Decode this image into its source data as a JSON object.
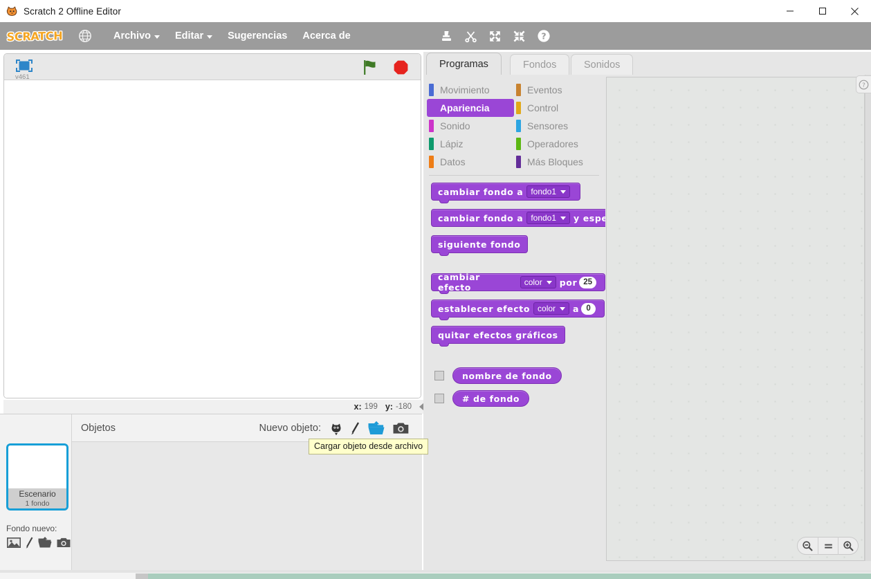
{
  "window": {
    "title": "Scratch 2 Offline Editor",
    "app_icon": "scratch-cat-icon",
    "controls": {
      "minimize": "minimize-icon",
      "maximize": "maximize-icon",
      "close": "close-icon"
    }
  },
  "menubar": {
    "logo": "SCRATCH",
    "globe_icon": "globe-icon",
    "items": [
      {
        "label": "Archivo",
        "has_caret": true
      },
      {
        "label": "Editar",
        "has_caret": true
      },
      {
        "label": "Sugerencias",
        "has_caret": false
      },
      {
        "label": "Acerca de",
        "has_caret": false
      }
    ],
    "tools": [
      "stamp-icon",
      "scissors-icon",
      "grow-icon",
      "shrink-icon",
      "help-icon"
    ]
  },
  "stage": {
    "version": "v461",
    "fullscreen_icon": "fullscreen-icon",
    "green_flag_icon": "green-flag-icon",
    "stop_icon": "stop-sign-icon",
    "coords": {
      "x_label": "x:",
      "x_value": "199",
      "y_label": "y:",
      "y_value": "-180"
    },
    "collapse_icon": "collapse-left-arrow-icon"
  },
  "sprite_pane": {
    "objects_label": "Objetos",
    "new_object_label": "Nuevo objeto:",
    "new_object_icons": [
      "choose-sprite-icon",
      "paint-sprite-icon",
      "upload-sprite-icon",
      "camera-sprite-icon"
    ],
    "stage_thumb": {
      "name": "Escenario",
      "detail": "1 fondo"
    },
    "new_backdrop_label": "Fondo nuevo:",
    "new_backdrop_icons": [
      "choose-backdrop-icon",
      "paint-backdrop-icon",
      "upload-backdrop-icon",
      "camera-backdrop-icon"
    ],
    "tooltip": "Cargar objeto desde archivo"
  },
  "editor": {
    "tabs": [
      {
        "label": "Programas",
        "active": true
      },
      {
        "label": "Fondos",
        "active": false
      },
      {
        "label": "Sonidos",
        "active": false
      }
    ],
    "categories": [
      {
        "label": "Movimiento",
        "color": "#4a6cd4",
        "selected": false
      },
      {
        "label": "Eventos",
        "color": "#c88330",
        "selected": false
      },
      {
        "label": "Apariencia",
        "color": "#9a46d6",
        "selected": true
      },
      {
        "label": "Control",
        "color": "#e1a91a",
        "selected": false
      },
      {
        "label": "Sonido",
        "color": "#cc34c9",
        "selected": false
      },
      {
        "label": "Sensores",
        "color": "#2ca5e2",
        "selected": false
      },
      {
        "label": "Lápiz",
        "color": "#0e9a6c",
        "selected": false
      },
      {
        "label": "Operadores",
        "color": "#5cb712",
        "selected": false
      },
      {
        "label": "Datos",
        "color": "#ee7d16",
        "selected": false
      },
      {
        "label": "Más Bloques",
        "color": "#632d99",
        "selected": false
      }
    ],
    "blocks": [
      {
        "id": "switch-backdrop",
        "shape": "stack",
        "parts": [
          {
            "type": "text",
            "value": "cambiar fondo a"
          },
          {
            "type": "dropdown",
            "value": "fondo1"
          }
        ]
      },
      {
        "id": "switch-backdrop-and-wait",
        "shape": "stack-clipped",
        "parts": [
          {
            "type": "text",
            "value": "cambiar fondo a"
          },
          {
            "type": "dropdown",
            "value": "fondo1"
          },
          {
            "type": "text",
            "value": "y espe"
          }
        ]
      },
      {
        "id": "next-backdrop",
        "shape": "stack",
        "parts": [
          {
            "type": "text",
            "value": "siguiente fondo"
          }
        ]
      },
      {
        "id": "change-effect-by",
        "shape": "stack",
        "parts": [
          {
            "type": "text",
            "value": "cambiar efecto"
          },
          {
            "type": "dropdown",
            "value": "color"
          },
          {
            "type": "text",
            "value": "por"
          },
          {
            "type": "number",
            "value": "25"
          }
        ]
      },
      {
        "id": "set-effect-to",
        "shape": "stack",
        "parts": [
          {
            "type": "text",
            "value": "establecer efecto"
          },
          {
            "type": "dropdown",
            "value": "color"
          },
          {
            "type": "text",
            "value": "a"
          },
          {
            "type": "number",
            "value": "0"
          }
        ]
      },
      {
        "id": "clear-graphic-effects",
        "shape": "stack",
        "parts": [
          {
            "type": "text",
            "value": "quitar efectos gráficos"
          }
        ]
      }
    ],
    "reporters": [
      {
        "id": "backdrop-name",
        "label": "nombre de fondo",
        "checked": false
      },
      {
        "id": "backdrop-number",
        "label": "# de fondo",
        "checked": false
      }
    ],
    "help_tab_icon": "question-mark-icon",
    "zoom_controls": [
      {
        "id": "zoom-out",
        "icon": "zoom-out-icon"
      },
      {
        "id": "zoom-reset",
        "icon": "equals-icon"
      },
      {
        "id": "zoom-in",
        "icon": "zoom-in-icon"
      }
    ]
  },
  "colors": {
    "menubar_bg": "#9c9c9c",
    "looks_purple": "#9a46d6",
    "selection_blue": "#179fd7",
    "logo_orange": "#f5a623",
    "tooltip_bg": "#ffffcb"
  }
}
